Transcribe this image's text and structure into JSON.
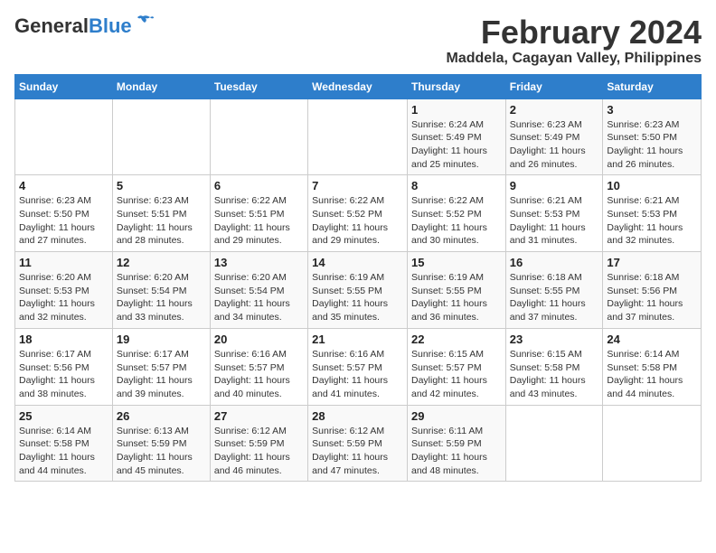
{
  "header": {
    "logo_general": "General",
    "logo_blue": "Blue",
    "title": "February 2024",
    "subtitle": "Maddela, Cagayan Valley, Philippines"
  },
  "columns": [
    "Sunday",
    "Monday",
    "Tuesday",
    "Wednesday",
    "Thursday",
    "Friday",
    "Saturday"
  ],
  "weeks": [
    [
      {
        "day": "",
        "info": ""
      },
      {
        "day": "",
        "info": ""
      },
      {
        "day": "",
        "info": ""
      },
      {
        "day": "",
        "info": ""
      },
      {
        "day": "1",
        "info": "Sunrise: 6:24 AM\nSunset: 5:49 PM\nDaylight: 11 hours and 25 minutes."
      },
      {
        "day": "2",
        "info": "Sunrise: 6:23 AM\nSunset: 5:49 PM\nDaylight: 11 hours and 26 minutes."
      },
      {
        "day": "3",
        "info": "Sunrise: 6:23 AM\nSunset: 5:50 PM\nDaylight: 11 hours and 26 minutes."
      }
    ],
    [
      {
        "day": "4",
        "info": "Sunrise: 6:23 AM\nSunset: 5:50 PM\nDaylight: 11 hours and 27 minutes."
      },
      {
        "day": "5",
        "info": "Sunrise: 6:23 AM\nSunset: 5:51 PM\nDaylight: 11 hours and 28 minutes."
      },
      {
        "day": "6",
        "info": "Sunrise: 6:22 AM\nSunset: 5:51 PM\nDaylight: 11 hours and 29 minutes."
      },
      {
        "day": "7",
        "info": "Sunrise: 6:22 AM\nSunset: 5:52 PM\nDaylight: 11 hours and 29 minutes."
      },
      {
        "day": "8",
        "info": "Sunrise: 6:22 AM\nSunset: 5:52 PM\nDaylight: 11 hours and 30 minutes."
      },
      {
        "day": "9",
        "info": "Sunrise: 6:21 AM\nSunset: 5:53 PM\nDaylight: 11 hours and 31 minutes."
      },
      {
        "day": "10",
        "info": "Sunrise: 6:21 AM\nSunset: 5:53 PM\nDaylight: 11 hours and 32 minutes."
      }
    ],
    [
      {
        "day": "11",
        "info": "Sunrise: 6:20 AM\nSunset: 5:53 PM\nDaylight: 11 hours and 32 minutes."
      },
      {
        "day": "12",
        "info": "Sunrise: 6:20 AM\nSunset: 5:54 PM\nDaylight: 11 hours and 33 minutes."
      },
      {
        "day": "13",
        "info": "Sunrise: 6:20 AM\nSunset: 5:54 PM\nDaylight: 11 hours and 34 minutes."
      },
      {
        "day": "14",
        "info": "Sunrise: 6:19 AM\nSunset: 5:55 PM\nDaylight: 11 hours and 35 minutes."
      },
      {
        "day": "15",
        "info": "Sunrise: 6:19 AM\nSunset: 5:55 PM\nDaylight: 11 hours and 36 minutes."
      },
      {
        "day": "16",
        "info": "Sunrise: 6:18 AM\nSunset: 5:55 PM\nDaylight: 11 hours and 37 minutes."
      },
      {
        "day": "17",
        "info": "Sunrise: 6:18 AM\nSunset: 5:56 PM\nDaylight: 11 hours and 37 minutes."
      }
    ],
    [
      {
        "day": "18",
        "info": "Sunrise: 6:17 AM\nSunset: 5:56 PM\nDaylight: 11 hours and 38 minutes."
      },
      {
        "day": "19",
        "info": "Sunrise: 6:17 AM\nSunset: 5:57 PM\nDaylight: 11 hours and 39 minutes."
      },
      {
        "day": "20",
        "info": "Sunrise: 6:16 AM\nSunset: 5:57 PM\nDaylight: 11 hours and 40 minutes."
      },
      {
        "day": "21",
        "info": "Sunrise: 6:16 AM\nSunset: 5:57 PM\nDaylight: 11 hours and 41 minutes."
      },
      {
        "day": "22",
        "info": "Sunrise: 6:15 AM\nSunset: 5:57 PM\nDaylight: 11 hours and 42 minutes."
      },
      {
        "day": "23",
        "info": "Sunrise: 6:15 AM\nSunset: 5:58 PM\nDaylight: 11 hours and 43 minutes."
      },
      {
        "day": "24",
        "info": "Sunrise: 6:14 AM\nSunset: 5:58 PM\nDaylight: 11 hours and 44 minutes."
      }
    ],
    [
      {
        "day": "25",
        "info": "Sunrise: 6:14 AM\nSunset: 5:58 PM\nDaylight: 11 hours and 44 minutes."
      },
      {
        "day": "26",
        "info": "Sunrise: 6:13 AM\nSunset: 5:59 PM\nDaylight: 11 hours and 45 minutes."
      },
      {
        "day": "27",
        "info": "Sunrise: 6:12 AM\nSunset: 5:59 PM\nDaylight: 11 hours and 46 minutes."
      },
      {
        "day": "28",
        "info": "Sunrise: 6:12 AM\nSunset: 5:59 PM\nDaylight: 11 hours and 47 minutes."
      },
      {
        "day": "29",
        "info": "Sunrise: 6:11 AM\nSunset: 5:59 PM\nDaylight: 11 hours and 48 minutes."
      },
      {
        "day": "",
        "info": ""
      },
      {
        "day": "",
        "info": ""
      }
    ]
  ]
}
